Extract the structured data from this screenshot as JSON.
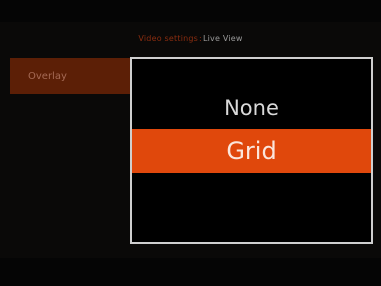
{
  "header": {
    "breadcrumb_parent": "Video settings",
    "separator": ":",
    "breadcrumb_current": "Live View"
  },
  "sidebar": {
    "selected_label": "Overlay"
  },
  "dropdown": {
    "options": [
      {
        "label": "None",
        "selected": false
      },
      {
        "label": "Grid",
        "selected": true
      }
    ]
  },
  "colors": {
    "accent": "#e0480c",
    "accent_dim": "#5c1f06",
    "border": "#cfcfcf",
    "background": "#0a0908"
  }
}
